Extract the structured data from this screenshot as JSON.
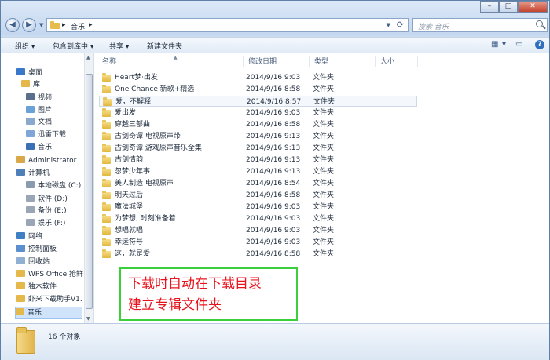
{
  "address": {
    "crumbs": [
      "音乐"
    ]
  },
  "search": {
    "placeholder": "搜索 音乐"
  },
  "window_buttons": {
    "minimize": "–",
    "maximize": "□",
    "close": "✕"
  },
  "toolbar": {
    "organize": "组织 ▾",
    "include_library": "包含到库中 ▾",
    "share": "共享 ▾",
    "new_folder": "新建文件夹"
  },
  "columns": {
    "name": "名称",
    "date": "修改日期",
    "type": "类型",
    "size": "大小"
  },
  "nav": [
    {
      "label": "桌面",
      "icon": "desktop-icon",
      "color": "#3a78c9"
    },
    {
      "label": "库",
      "icon": "library-icon",
      "color": "#e4b84a"
    },
    {
      "label": "视频",
      "icon": "video-icon",
      "color": "#5a6f8e"
    },
    {
      "label": "图片",
      "icon": "pictures-icon",
      "color": "#6aa2d8"
    },
    {
      "label": "文档",
      "icon": "documents-icon",
      "color": "#8aa9cc"
    },
    {
      "label": "迅雷下载",
      "icon": "download-folder-icon",
      "color": "#7fa6d6"
    },
    {
      "label": "音乐",
      "icon": "music-icon",
      "color": "#3b6fb6"
    },
    {
      "label": "Administrator",
      "icon": "user-icon",
      "color": "#d9a84a"
    },
    {
      "label": "计算机",
      "icon": "computer-icon",
      "color": "#4f7fb9"
    },
    {
      "label": "本地磁盘 (C:)",
      "icon": "drive-c-icon",
      "color": "#8a9bb0"
    },
    {
      "label": "软件 (D:)",
      "icon": "drive-d-icon",
      "color": "#9aa6b5"
    },
    {
      "label": "备份 (E:)",
      "icon": "drive-e-icon",
      "color": "#9aa6b5"
    },
    {
      "label": "娱乐 (F:)",
      "icon": "drive-f-icon",
      "color": "#9aa6b5"
    },
    {
      "label": "网络",
      "icon": "network-icon",
      "color": "#3f7fc4"
    },
    {
      "label": "控制面板",
      "icon": "control-panel-icon",
      "color": "#5b8fce"
    },
    {
      "label": "回收站",
      "icon": "recycle-bin-icon",
      "color": "#8fb0d3"
    },
    {
      "label": "WPS Office 抢鲜",
      "icon": "folder-icon",
      "color": "#e4b84a"
    },
    {
      "label": "独木软件",
      "icon": "folder-icon",
      "color": "#e4b84a"
    },
    {
      "label": "虾米下载助手V1.",
      "icon": "folder-icon",
      "color": "#e4b84a"
    },
    {
      "label": "音乐",
      "icon": "folder-icon",
      "color": "#e4b84a"
    }
  ],
  "files": [
    {
      "name": "Heart梦·出发",
      "date": "2014/9/16 9:03",
      "type": "文件夹"
    },
    {
      "name": "One Chance 新歌+精选",
      "date": "2014/9/16 8:58",
      "type": "文件夹"
    },
    {
      "name": "爱，不解释",
      "date": "2014/9/16 8:57",
      "type": "文件夹"
    },
    {
      "name": "爱出发",
      "date": "2014/9/16 9:03",
      "type": "文件夹"
    },
    {
      "name": "穿越三部曲",
      "date": "2014/9/16 8:58",
      "type": "文件夹"
    },
    {
      "name": "古剑奇谭 电视原声带",
      "date": "2014/9/16 9:13",
      "type": "文件夹"
    },
    {
      "name": "古剑奇谭 游戏原声音乐全集",
      "date": "2014/9/16 9:13",
      "type": "文件夹"
    },
    {
      "name": "古剑情韵",
      "date": "2014/9/16 9:13",
      "type": "文件夹"
    },
    {
      "name": "忽梦少年事",
      "date": "2014/9/16 9:13",
      "type": "文件夹"
    },
    {
      "name": "美人制造 电视原声",
      "date": "2014/9/16 8:54",
      "type": "文件夹"
    },
    {
      "name": "明天过后",
      "date": "2014/9/16 8:58",
      "type": "文件夹"
    },
    {
      "name": "魔法城堡",
      "date": "2014/9/16 9:03",
      "type": "文件夹"
    },
    {
      "name": "为梦想, 时刻准备着",
      "date": "2014/9/16 9:03",
      "type": "文件夹"
    },
    {
      "name": "想唱就唱",
      "date": "2014/9/16 9:03",
      "type": "文件夹"
    },
    {
      "name": "幸运符号",
      "date": "2014/9/16 9:03",
      "type": "文件夹"
    },
    {
      "name": "这，就是爱",
      "date": "2014/9/16 8:58",
      "type": "文件夹"
    }
  ],
  "annotation": {
    "line1": "下载时自动在下载目录",
    "line2": "建立专辑文件夹",
    "text_color": "#e8141d",
    "border_color": "#3ccf3c"
  },
  "status": {
    "count": "16 个对象"
  }
}
